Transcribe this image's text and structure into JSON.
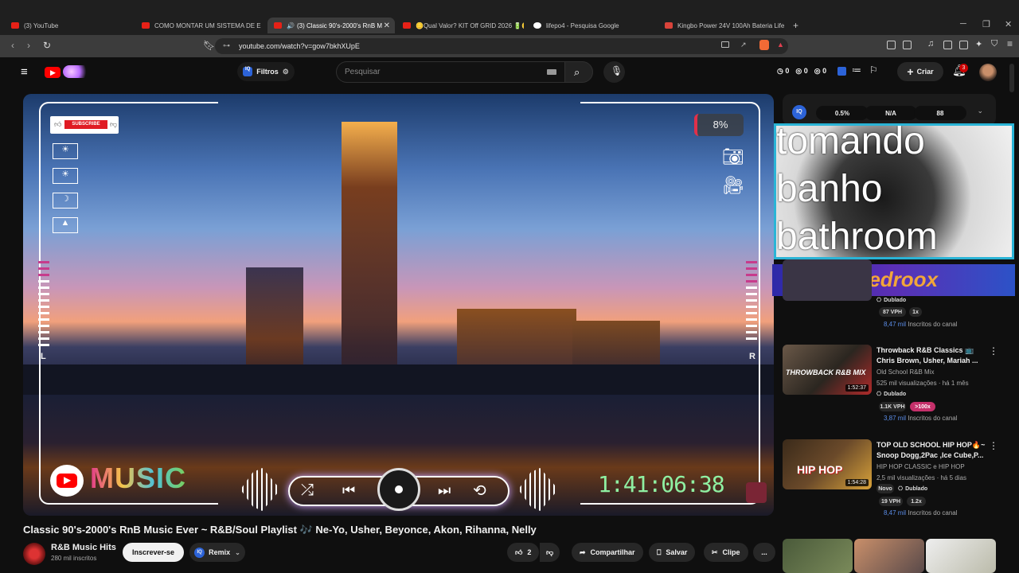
{
  "browser": {
    "tabs": [
      {
        "label": "(3) YouTube"
      },
      {
        "label": "COMO MONTAR UM SISTEMA DE EN"
      },
      {
        "label": "(3) Classic 90's-2000's RnB M"
      },
      {
        "label": "🪙Qual Valor? KIT Off GRID 2026 🔋🪙"
      },
      {
        "label": "lifepo4 - Pesquisa Google"
      },
      {
        "label": "Kingbo Power 24V 100Ah Bateria Life"
      }
    ],
    "new_tab": "+",
    "url": "youtube.com/watch?v=gow7bkhXUpE"
  },
  "header": {
    "filters_label": "Filtros",
    "search_placeholder": "Pesquisar",
    "counters": [
      "0",
      "0",
      "0"
    ],
    "create_label": "Criar",
    "notif_count": "3"
  },
  "player": {
    "subscribe_badge": "SUBSCRIBE",
    "percent": "8%",
    "left_label": "L",
    "right_label": "R",
    "music_logo": "MUSIC",
    "timer": "1:41:06:38"
  },
  "sidebar": {
    "stats": [
      "0.5%",
      "N/A",
      "88"
    ],
    "overlay_text": [
      "tomando",
      "banho",
      "bathroom"
    ],
    "banner_text": "Pedroox",
    "items": [
      {
        "title_lines": [],
        "channel": "",
        "meta": "",
        "tag": "Dublado",
        "chips": [
          "87 VPH",
          "1x"
        ],
        "subs": "8,47 mil",
        "subs_suffix": "Inscritos do canal"
      },
      {
        "title_lines": [
          "Throwback R&B Classics 📺",
          "Chris Brown, Usher, Mariah ..."
        ],
        "channel": "Old School R&B Mix",
        "meta": "525 mil visualizações · há 1 mês",
        "tag": "Dublado",
        "chips": [
          "1.1K VPH",
          ">100x"
        ],
        "subs": "3,87 mil",
        "subs_suffix": "Inscritos do canal",
        "duration": "1:52:37",
        "thumb_text": "THROWBACK R&B MIX"
      },
      {
        "title_lines": [
          "TOP OLD SCHOOL HIP HOP🔥~",
          "Snoop Dogg,2Pac ,Ice Cube,P..."
        ],
        "channel": "HIP HOP CLASSIC e HIP HOP",
        "meta": "2,5 mil visualizações · há 5 dias",
        "badge_new": "Novo",
        "tag": "Dublado",
        "chips": [
          "19 VPH",
          "1.2x"
        ],
        "subs": "8,47 mil",
        "subs_suffix": "Inscritos do canal",
        "duration": "1:54:28",
        "thumb_text": "HIP HOP"
      }
    ]
  },
  "video": {
    "title": "Classic 90's-2000's RnB Music Ever ~ R&B/Soul Playlist 🎶 Ne-Yo, Usher, Beyonce, Akon, Rihanna, Nelly",
    "channel": "R&B Music Hits",
    "subscribers": "280 mil inscritos",
    "subscribe_label": "Inscrever-se",
    "remix_label": "Remix",
    "likes": "2",
    "share_label": "Compartilhar",
    "save_label": "Salvar",
    "clip_label": "Clipe",
    "more_label": "..."
  }
}
